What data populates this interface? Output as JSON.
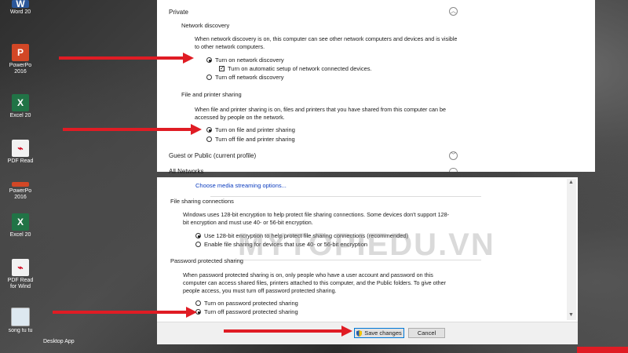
{
  "desktop": {
    "icons": [
      {
        "label": "Word 20",
        "icon": "word-icon"
      },
      {
        "label": "PowerPo 2016",
        "icon": "powerpoint-icon"
      },
      {
        "label": "Excel 20",
        "icon": "excel-icon"
      },
      {
        "label": "PDF Read",
        "icon": "pdf-icon"
      },
      {
        "label": "PowerPo 2016",
        "icon": "powerpoint-icon"
      },
      {
        "label": "Excel 20",
        "icon": "excel-icon"
      },
      {
        "label": "PDF Read for Wind",
        "icon": "pdf-icon"
      },
      {
        "label": "song tu tu",
        "icon": "image-icon"
      }
    ],
    "taskbar_label": "Desktop App",
    "watermark": "MYTOPIEDU.VN"
  },
  "private": {
    "section": "Private",
    "network_discovery": {
      "heading": "Network discovery",
      "description": "When network discovery is on, this computer can see other network computers and devices and is visible to other network computers.",
      "options": [
        "Turn on network discovery",
        "Turn off network discovery"
      ],
      "selected": 0,
      "auto_setup_label": "Turn on automatic setup of network connected devices.",
      "auto_setup_checked": true
    },
    "file_printer_sharing": {
      "heading": "File and printer sharing",
      "description": "When file and printer sharing is on, files and printers that you have shared from this computer can be accessed by people on the network.",
      "options": [
        "Turn on file and printer sharing",
        "Turn off file and printer sharing"
      ],
      "selected": 0
    }
  },
  "guest_public": "Guest or Public (current profile)",
  "all_networks": "All Networks",
  "all_networks_bottom": {
    "media_link": "Choose media streaming options...",
    "file_sharing_connections": {
      "heading": "File sharing connections",
      "description": "Windows uses 128-bit encryption to help protect file sharing connections. Some devices don't support 128-bit encryption and must use 40- or 56-bit encryption.",
      "options": [
        "Use 128-bit encryption to help protect file sharing connections (recommended)",
        "Enable file sharing for devices that use 40- or 56-bit encryption"
      ],
      "selected": 0
    },
    "password_sharing": {
      "heading": "Password protected sharing",
      "description": "When password protected sharing is on, only people who have a user account and password on this computer can access shared files, printers attached to this computer, and the Public folders. To give other people access, you must turn off password protected sharing.",
      "options": [
        "Turn on password protected sharing",
        "Turn off password protected sharing"
      ],
      "selected": 1
    }
  },
  "footer": {
    "save_label": "Save changes",
    "cancel_label": "Cancel"
  },
  "colors": {
    "annotation_arrow": "#e01c24",
    "link": "#0b3cbf"
  }
}
